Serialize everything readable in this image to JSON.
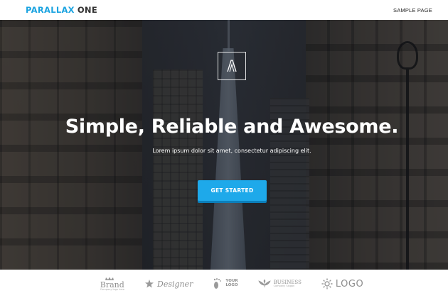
{
  "header": {
    "brand_part1": "PARALLAX",
    "brand_part2": "ONE",
    "nav_link": "SAMPLE PAGE"
  },
  "hero": {
    "logo_glyph": "Λ",
    "title": "Simple, Reliable and Awesome.",
    "subtitle": "Lorem ipsum dolor sit amet, consectetur adipiscing elit.",
    "cta_label": "GET STARTED"
  },
  "logos": {
    "brand_main": "Brand",
    "brand_small": "Company logo here",
    "designer": "Designer",
    "your_line1": "YOUR",
    "your_line2": "LOGO",
    "business_main": "BUSINESS",
    "business_small": "Company Slogan",
    "logo_text": "LOGO"
  },
  "colors": {
    "accent": "#1ea9ea",
    "brand_blue": "#1aa3e0"
  }
}
